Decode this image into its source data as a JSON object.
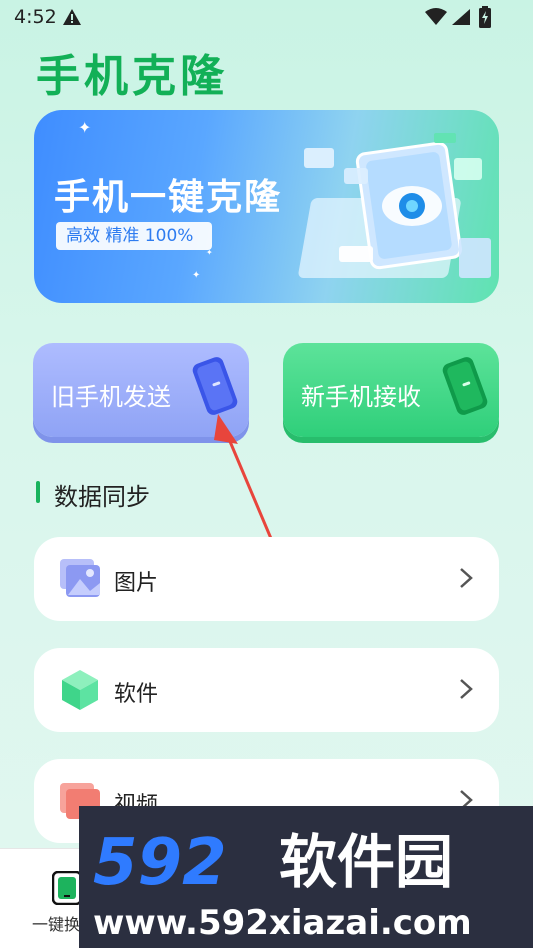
{
  "status_bar": {
    "time": "4:52"
  },
  "app_title": "手机克隆",
  "banner": {
    "title": "手机一键克隆",
    "subtitle": "高效 精准 100%"
  },
  "actions": {
    "send_label": "旧手机发送",
    "receive_label": "新手机接收"
  },
  "section": {
    "title": "数据同步"
  },
  "sync_items": [
    {
      "label": "图片",
      "icon": "image-icon"
    },
    {
      "label": "软件",
      "icon": "app-cube-icon"
    },
    {
      "label": "视频",
      "icon": "video-icon"
    }
  ],
  "bottom_nav": {
    "items": [
      {
        "label": "一键换"
      }
    ]
  },
  "watermark": {
    "brand": "592软件园",
    "url": "www.592xiazai.com"
  },
  "colors": {
    "accent_green": "#12b057",
    "send_blue": "#8fa3f5",
    "receive_green": "#2fcf7a",
    "annotation_red": "#e8453c"
  }
}
